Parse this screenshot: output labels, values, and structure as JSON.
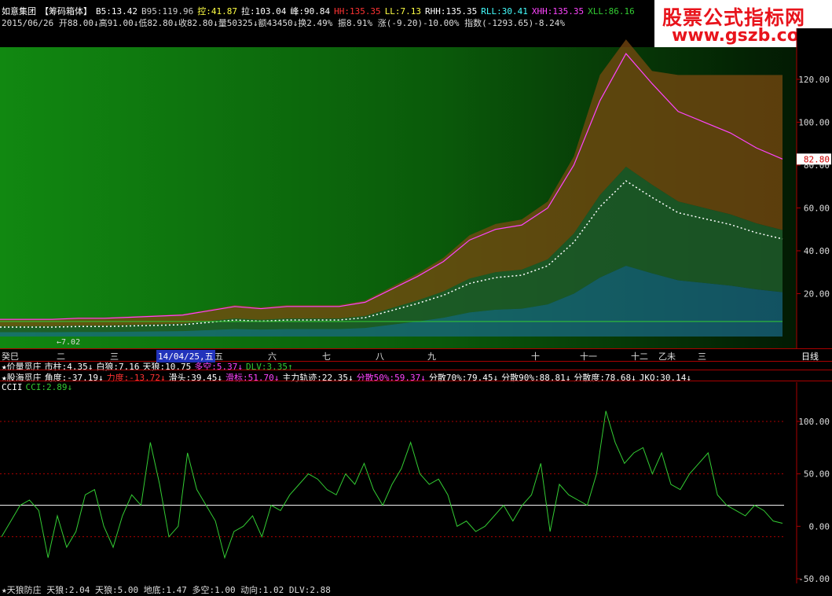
{
  "header": {
    "stock_name": "如意集团",
    "indicator_name": "【筹码箱体】",
    "items_line1": [
      {
        "text": "B5:13.42",
        "color": "#ffffff"
      },
      {
        "text": "B95:119.96",
        "color": "#cccccc"
      },
      {
        "text": "控:41.87",
        "color": "#ffff44"
      },
      {
        "text": "拉:103.04",
        "color": "#ffffff"
      },
      {
        "text": "峰:90.84",
        "color": "#ffffff"
      },
      {
        "text": "HH:135.35",
        "color": "#ff3333"
      },
      {
        "text": "LL:7.13",
        "color": "#ffff44"
      },
      {
        "text": "RHH:135.35",
        "color": "#ffffff"
      },
      {
        "text": "RLL:30.41",
        "color": "#44ffff"
      },
      {
        "text": "XHH:135.35",
        "color": "#ff44ff"
      },
      {
        "text": "XLL:86.16",
        "color": "#33cc33"
      }
    ],
    "line2": "2015/06/26 开88.00↓高91.00↓低82.80↓收82.80↓量50325↓额43450↓换2.49% 振8.91% 涨(-9.20)-10.00% 指数(-1293.65)-8.24%"
  },
  "watermark": {
    "line1": "股票公式指标网",
    "line2": "www.gszb.com"
  },
  "price_chart": {
    "y_ticks": [
      "120.00",
      "100.00",
      "80.00",
      "60.00",
      "40.00",
      "20.00"
    ],
    "last_price": "82.80",
    "low_label": "7.02"
  },
  "time_axis": {
    "labels": [
      "癸巳",
      "二",
      "三",
      "14/04/25,五",
      "五",
      "六",
      "七",
      "八",
      "九",
      "十",
      "十一",
      "十二",
      "乙未",
      "三"
    ],
    "period": "日线"
  },
  "indicators": {
    "line1": [
      {
        "text": "★价量觅庄",
        "color": "#ffffff"
      },
      {
        "text": "市柱:4.35↓",
        "color": "#ffffff"
      },
      {
        "text": "白狼:7.16",
        "color": "#ffffff"
      },
      {
        "text": "天狼:10.75",
        "color": "#ffffff"
      },
      {
        "text": "多空:5.37↓",
        "color": "#ff44ff"
      },
      {
        "text": "DLV:3.35↑",
        "color": "#33cc33"
      }
    ],
    "line2": [
      {
        "text": "★股海觅庄",
        "color": "#ffffff"
      },
      {
        "text": "角度:-37.19↓",
        "color": "#ffffff"
      },
      {
        "text": "力度:-13.72↓",
        "color": "#ff3333"
      },
      {
        "text": "滑头:39.45↓",
        "color": "#ffffff"
      },
      {
        "text": "滑标:51.70↓",
        "color": "#ff44ff"
      },
      {
        "text": "主力轨迹:22.35↓",
        "color": "#ffffff"
      },
      {
        "text": "分散50%:59.37↓",
        "color": "#ff44ff"
      },
      {
        "text": "分散70%:79.45↓",
        "color": "#ffffff"
      },
      {
        "text": "分散90%:88.81↓",
        "color": "#ffffff"
      },
      {
        "text": "分散度:78.68↓",
        "color": "#ffffff"
      },
      {
        "text": "JKQ:30.14↓",
        "color": "#ffffff"
      }
    ],
    "line3": [
      {
        "text": "CCII",
        "color": "#ffffff"
      },
      {
        "text": "CCI:2.89↓",
        "color": "#33cc33"
      }
    ]
  },
  "bottom_line": "★天狼防庄 天狼:2.04 天狼:5.00 地底:1.47 多空:1.00 动向:1.02 DLV:2.88",
  "chart_data": [
    {
      "type": "line",
      "title": "价格 (筹码箱体)",
      "ylim": [
        0,
        135
      ],
      "y_ticks": [
        20,
        40,
        60,
        80,
        100,
        120
      ],
      "series": [
        {
          "name": "close",
          "values": [
            8,
            8,
            8,
            8.5,
            8.5,
            9,
            9.5,
            10,
            12,
            14,
            13,
            14,
            14,
            14,
            16,
            22,
            28,
            35,
            45,
            50,
            52,
            60,
            80,
            110,
            132,
            118,
            105,
            100,
            95,
            88,
            82.8
          ]
        }
      ]
    },
    {
      "type": "line",
      "title": "CCII",
      "ylim": [
        -50,
        130
      ],
      "y_ticks": [
        -50,
        0,
        50,
        100
      ],
      "reference_lines": [
        20
      ],
      "series": [
        {
          "name": "CCI",
          "values": [
            -10,
            5,
            20,
            25,
            15,
            -30,
            10,
            -20,
            -5,
            30,
            35,
            0,
            -20,
            10,
            30,
            20,
            80,
            40,
            -10,
            0,
            70,
            35,
            20,
            5,
            -30,
            -5,
            0,
            10,
            -10,
            20,
            15,
            30,
            40,
            50,
            45,
            35,
            30,
            50,
            40,
            60,
            35,
            20,
            40,
            55,
            80,
            50,
            40,
            45,
            30,
            0,
            5,
            -5,
            0,
            10,
            20,
            5,
            20,
            30,
            60,
            -5,
            40,
            30,
            25,
            20,
            50,
            110,
            80,
            60,
            70,
            75,
            50,
            70,
            40,
            35,
            50,
            60,
            70,
            30,
            20,
            15,
            10,
            20,
            15,
            5,
            2.89
          ]
        }
      ]
    }
  ]
}
